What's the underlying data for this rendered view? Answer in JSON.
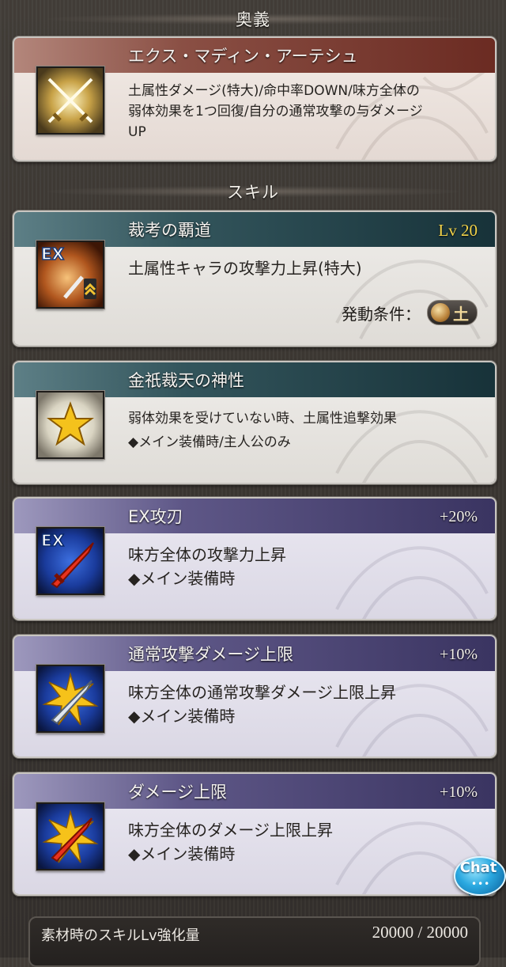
{
  "sections": {
    "ougi_header": "奥義",
    "skill_header": "スキル"
  },
  "ougi": {
    "name": "エクス・マディン・アーテシュ",
    "desc_lines": [
      "土属性ダメージ(特大)/命中率DOWN/味方全体の",
      "弱体効果を1つ回復/自分の通常攻撃の与ダメージ",
      "UP"
    ],
    "icon": "crossed-swords-icon"
  },
  "skills": [
    {
      "name": "裁考の覇道",
      "level": "Lv 20",
      "desc_lines": [
        "土属性キャラの攻撃力上昇(特大)"
      ],
      "condition_label": "発動条件：",
      "condition_element": "土",
      "icon": "ex-sword-boost-icon",
      "badge": "EX"
    },
    {
      "name": "金祇裁天の神性",
      "desc_lines": [
        "弱体効果を受けていない時、土属性追撃効果",
        "◆メイン装備時/主人公のみ"
      ],
      "icon": "gold-star-icon"
    }
  ],
  "aura_skills": [
    {
      "name": "EX攻刃",
      "percent": "+20%",
      "desc_lines": [
        "味方全体の攻撃力上昇",
        "◆メイン装備時"
      ],
      "icon": "ex-red-sword-icon",
      "badge": "EX"
    },
    {
      "name": "通常攻撃ダメージ上限",
      "percent": "+10%",
      "desc_lines": [
        "味方全体の通常攻撃ダメージ上限上昇",
        "◆メイン装備時"
      ],
      "icon": "silver-sword-burst-icon"
    },
    {
      "name": "ダメージ上限",
      "percent": "+10%",
      "desc_lines": [
        "味方全体のダメージ上限上昇",
        "◆メイン装備時"
      ],
      "icon": "red-sword-burst-icon"
    }
  ],
  "footer": {
    "label": "素材時のスキルLv強化量",
    "value": "20000 / 20000"
  },
  "chat": {
    "label": "Chat",
    "dots": "•••"
  },
  "colors": {
    "ougi_titlebar": "#6b2b22",
    "skill_titlebar": "#173239",
    "aura_titlebar": "#3a3461",
    "level_text": "#f3d44a"
  }
}
